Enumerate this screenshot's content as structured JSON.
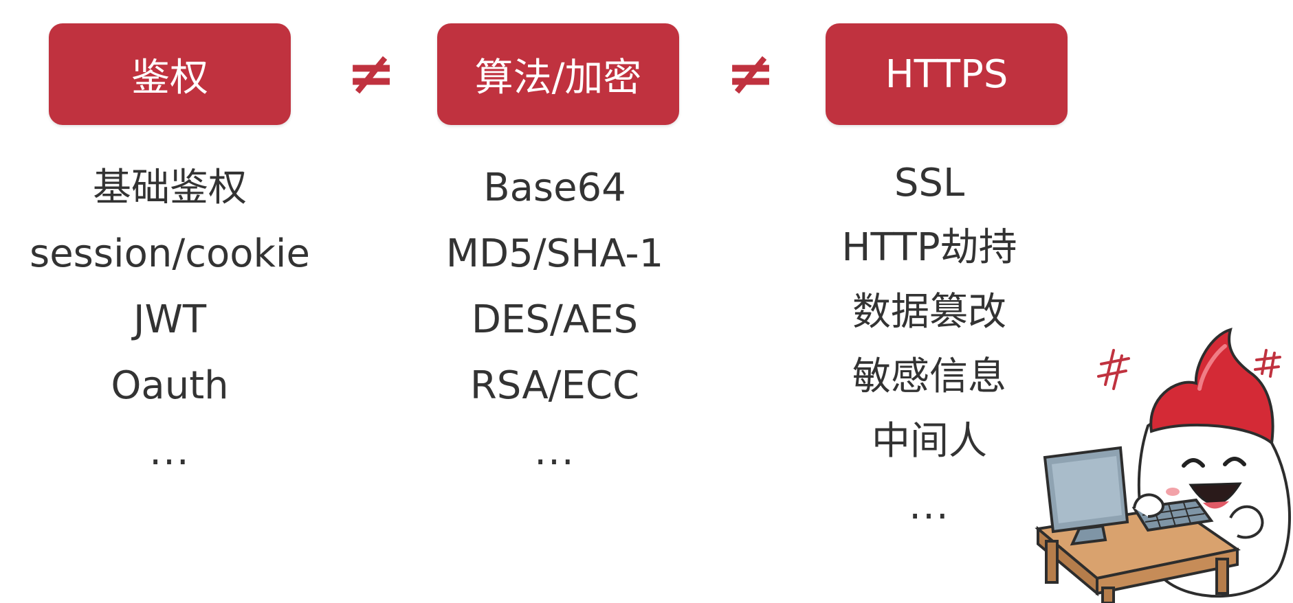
{
  "header": {
    "tags": [
      "鉴权",
      "算法/加密",
      "HTTPS"
    ],
    "separator": "≠"
  },
  "columns": [
    [
      "基础鉴权",
      "session/cookie",
      "JWT",
      "Oauth",
      "..."
    ],
    [
      "Base64",
      "MD5/SHA-1",
      "DES/AES",
      "RSA/ECC",
      "..."
    ],
    [
      "SSL",
      "HTTP劫持",
      "数据篡改",
      "敏感信息",
      "中间人",
      "..."
    ]
  ],
  "colors": {
    "accent": "#c0323f",
    "text": "#333333",
    "background": "#ffffff"
  },
  "icons": [
    "mascot-illustration",
    "computer-icon"
  ]
}
